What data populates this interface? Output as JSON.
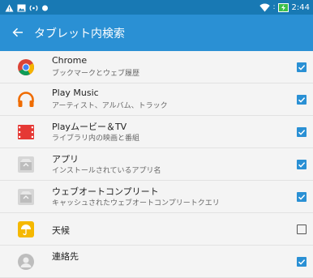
{
  "status_bar": {
    "time": "2:44",
    "separator": ":"
  },
  "app_bar": {
    "title": "タブレット内検索"
  },
  "items": [
    {
      "title": "Chrome",
      "subtitle": "ブックマークとウェブ履歴",
      "checked": true,
      "icon": "chrome-icon"
    },
    {
      "title": "Play Music",
      "subtitle": "アーティスト、アルバム、トラック",
      "checked": true,
      "icon": "play-music-icon"
    },
    {
      "title": "Playムービー＆TV",
      "subtitle": "ライブラリ内の映画と番組",
      "checked": true,
      "icon": "play-movies-icon"
    },
    {
      "title": "アプリ",
      "subtitle": "インストールされているアプリ名",
      "checked": true,
      "icon": "apps-icon"
    },
    {
      "title": "ウェブオートコンプリート",
      "subtitle": "キャッシュされたウェブオートコンプリートクエリ",
      "checked": true,
      "icon": "web-autocomplete-icon"
    },
    {
      "title": "天候",
      "subtitle": "",
      "checked": false,
      "icon": "weather-icon"
    },
    {
      "title": "連絡先",
      "subtitle": "",
      "checked": true,
      "icon": "contacts-icon"
    }
  ],
  "colors": {
    "status_bar": "#1879b4",
    "app_bar": "#2a90d4",
    "accent": "#2a90d4",
    "background": "#f4f4f4"
  }
}
